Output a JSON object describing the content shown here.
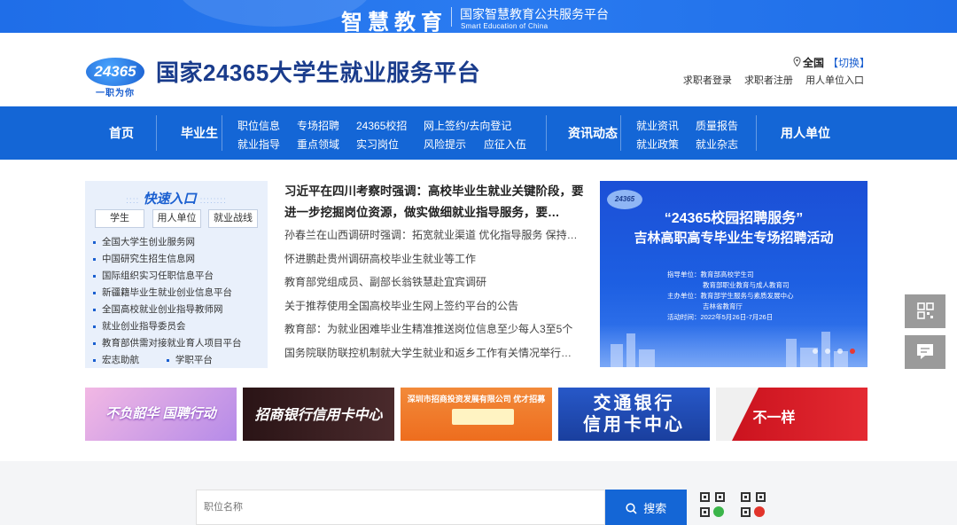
{
  "topbar": {
    "brand": "智慧教育",
    "cn_name": "国家智慧教育公共服务平台",
    "en_name": "Smart Education of China"
  },
  "header": {
    "logo_number": "24365",
    "logo_slogan": "一职为你",
    "title": "国家24365大学生就业服务平台",
    "region": "全国",
    "region_switch": "【切换】",
    "links": [
      "求职者登录",
      "求职者注册",
      "用人单位入口"
    ]
  },
  "nav": {
    "home": "首页",
    "graduates": "毕业生",
    "graduate_sub": [
      "职位信息",
      "专场招聘",
      "24365校招",
      "网上签约/去向登记",
      "就业指导",
      "重点领域",
      "实习岗位",
      "风险提示",
      "应征入伍"
    ],
    "news": "资讯动态",
    "news_sub": [
      "就业资讯",
      "质量报告",
      "就业政策",
      "就业杂志"
    ],
    "employers": "用人单位"
  },
  "quick": {
    "title": "快速入口",
    "tabs": [
      "学生",
      "用人单位",
      "就业战线"
    ],
    "links": [
      "全国大学生创业服务网",
      "中国研究生招生信息网",
      "国际组织实习任职信息平台",
      "新疆籍毕业生就业创业信息平台",
      "全国高校就业创业指导教师网",
      "就业创业指导委员会",
      "教育部供需对接就业育人项目平台"
    ],
    "last_row": [
      "宏志助航",
      "学职平台"
    ]
  },
  "news": {
    "headline": "习近平在四川考察时强调：高校毕业生就业关键阶段，要进一步挖掘岗位资源，做实做细就业指导服务，要…",
    "items": [
      "孙春兰在山西调研时强调：拓宽就业渠道 优化指导服务 保持…",
      "怀进鹏赴贵州调研高校毕业生就业等工作",
      "教育部党组成员、副部长翁铁慧赴宜宾调研",
      "关于推荐使用全国高校毕业生网上签约平台的公告",
      "教育部：为就业困难毕业生精准推送岗位信息至少每人3至5个",
      "国务院联防联控机制就大学生就业和返乡工作有关情况举行…"
    ]
  },
  "slide": {
    "logo": "24365",
    "title1": "“24365校园招聘服务”",
    "title2": "吉林高职高专毕业生专场招聘活动",
    "info": [
      "指导单位：教育部高校学生司",
      "教育部职业教育与成人教育司",
      "主办单位：教育部学生服务与素质发展中心",
      "吉林省教育厅",
      "活动时间：2022年5月26日-7月26日"
    ]
  },
  "ads": [
    {
      "text": "不负韶华 国聘行动",
      "bg": "#e9a6d6"
    },
    {
      "text": "招商银行信用卡中心",
      "bg": "#3a1f22"
    },
    {
      "text": "深圳市招商投资发展有限公司 优才招募",
      "bg": "#f07a2a"
    },
    {
      "text": "交通银行 信用卡中心",
      "bg": "#1f4fb7"
    },
    {
      "text": "不一样",
      "bg": "#d8202a"
    }
  ],
  "search": {
    "placeholder": "职位名称",
    "button": "搜索"
  },
  "colors": {
    "primary": "#1466d6",
    "topbar": "#2a7bf0",
    "title": "#1a3c8c"
  }
}
